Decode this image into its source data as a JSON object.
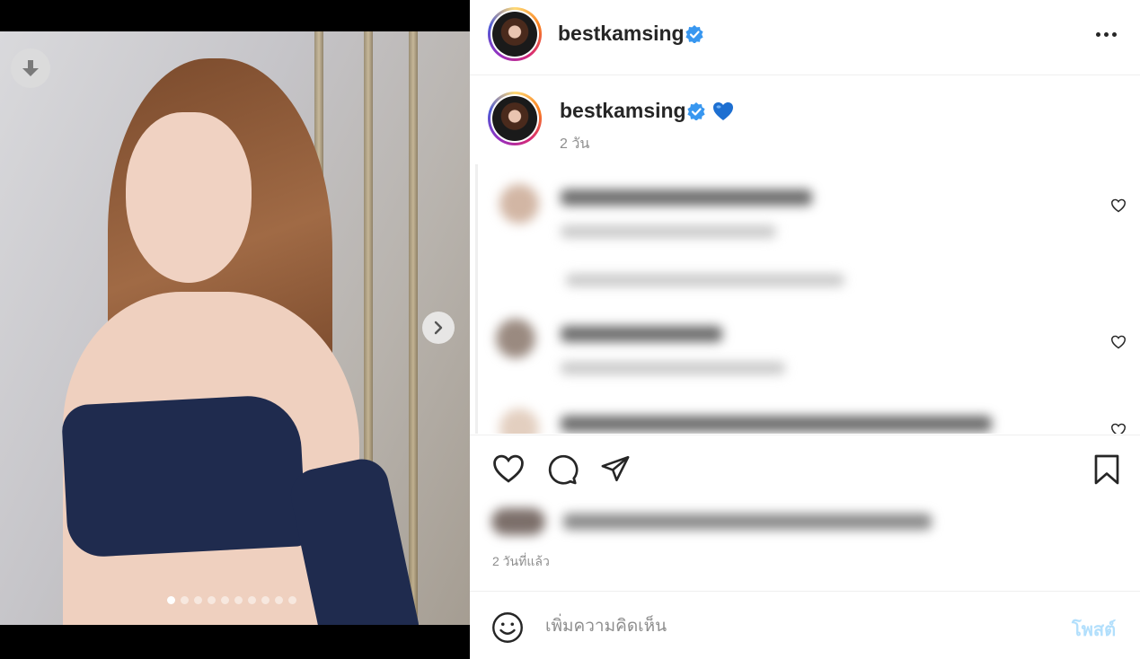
{
  "post": {
    "username": "bestkamsing",
    "verified_icon": "verified-badge-icon",
    "caption_emoji": "blue-heart",
    "caption_age": "2 วัน",
    "posted_time": "2 วันที่แล้ว"
  },
  "media": {
    "slide_count": 10,
    "active_slide": 1
  },
  "comment_box": {
    "placeholder": "เพิ่มความคิดเห็น",
    "post_label": "โพสต์"
  },
  "colors": {
    "verified": "#3897f0",
    "heart_emoji": "#1d6fd1",
    "post_disabled": "#b2dffc",
    "secondary_text": "#8e8e8e"
  }
}
